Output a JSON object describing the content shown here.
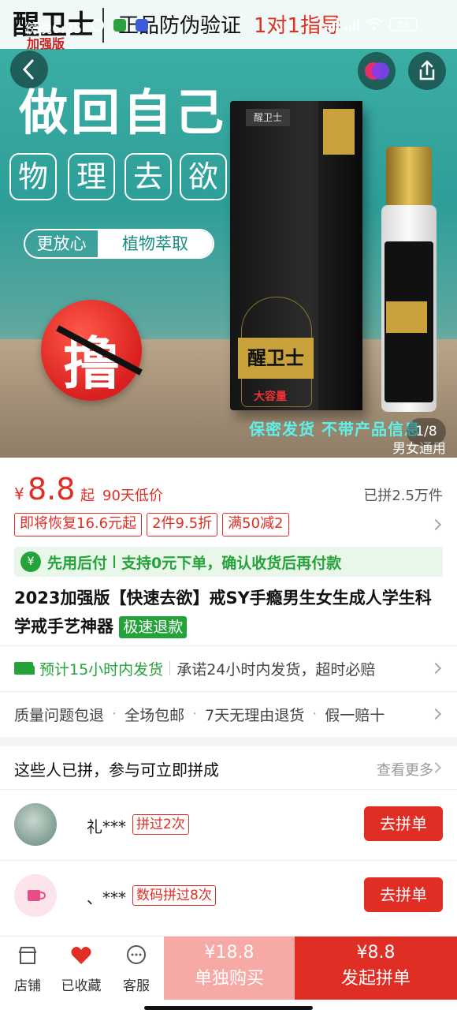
{
  "status_bar": {
    "time": "傍晚6:25",
    "battery": "86"
  },
  "hero": {
    "banner_brand": "醒卫士",
    "banner_brand_sub": "加强版",
    "banner_genuine": "正品防伪验证",
    "banner_guide": "1对1指导",
    "slogan": "做回自己",
    "tags": [
      "物",
      "理",
      "去",
      "欲"
    ],
    "pill_left": "更放心",
    "pill_right": "植物萃取",
    "ban_char": "撸",
    "box_name": "醒卫士",
    "box_capacity_label": "大容量",
    "box_small_logo": "醒卫士",
    "slogan2": "保密发货 不带产品信息",
    "unisex": "男女通用",
    "pager": "1/8"
  },
  "price": {
    "currency": "¥",
    "value": "8.8",
    "suffix": "起",
    "lowest": "90天低价",
    "sold": "已拼2.5万件"
  },
  "coupons": [
    "即将恢复16.6元起",
    "2件9.5折",
    "满50减2"
  ],
  "paylater": {
    "icon": "¥",
    "title": "先用后付",
    "text": "支持0元下单，确认收货后再付款"
  },
  "product": {
    "title": "2023加强版【快速去欲】戒SY手瘾男生女生成人学生科学戒手艺神器",
    "fast_refund": "极速退款"
  },
  "shipping": {
    "eta": "预计15小时内发货",
    "promise": "承诺24小时内发货，超时必赔"
  },
  "services": [
    "质量问题包退",
    "全场包邮",
    "7天无理由退货",
    "假一赔十"
  ],
  "group": {
    "title": "这些人已拼，参与可立即拼成",
    "more": "查看更多",
    "rows": [
      {
        "name": "礼***",
        "badge": "拼过2次",
        "button": "去拼单"
      },
      {
        "name": "、***",
        "badge": "数码拼过8次",
        "button": "去拼单"
      }
    ]
  },
  "bottom_bar": {
    "shop": "店铺",
    "favorited": "已收藏",
    "service": "客服",
    "solo_price": "¥18.8",
    "solo_label": "单独购买",
    "group_price": "¥8.8",
    "group_label": "发起拼单"
  },
  "colors": {
    "accent_red": "#e02e24",
    "accent_green": "#25a33a",
    "solo_pink": "#f6a9a5"
  }
}
